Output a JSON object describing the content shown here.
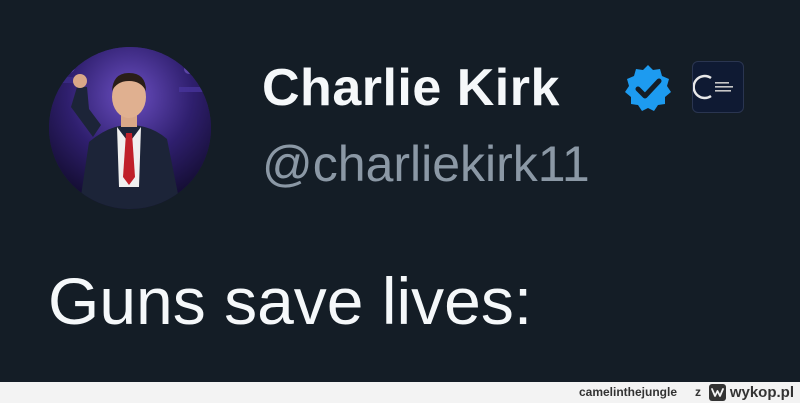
{
  "tweet": {
    "display_name": "Charlie Kirk",
    "handle": "@charliekirk11",
    "text": "Guns save lives:",
    "verified": true,
    "colors": {
      "background": "#141d26",
      "name": "#f5f8fa",
      "handle": "#8b98a5",
      "verified_badge": "#1d9bf0"
    },
    "icons": {
      "avatar": "profile-photo",
      "verified": "verified-badge-icon",
      "affiliate": "affiliate-org-badge-icon"
    }
  },
  "footer": {
    "username": "camelinthejungle",
    "separator": "z",
    "site": "wykop.pl",
    "icon": "wykop-logo-icon"
  }
}
